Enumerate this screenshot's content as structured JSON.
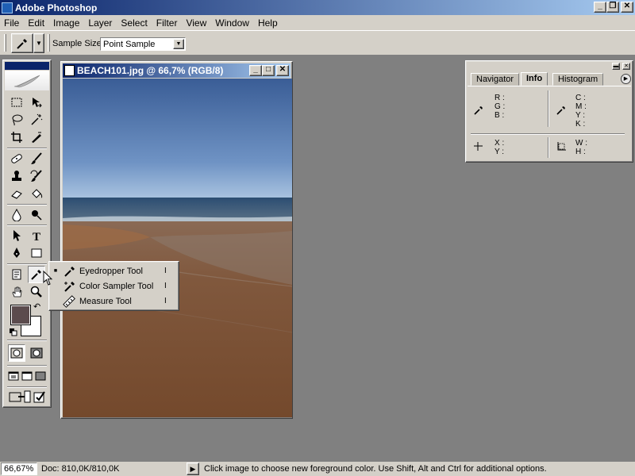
{
  "app": {
    "title": "Adobe Photoshop"
  },
  "menu": [
    "File",
    "Edit",
    "Image",
    "Layer",
    "Select",
    "Filter",
    "View",
    "Window",
    "Help"
  ],
  "options": {
    "sample_size_label": "Sample Size:",
    "sample_size_value": "Point Sample"
  },
  "document": {
    "title": "BEACH101.jpg @ 66,7% (RGB/8)"
  },
  "toolbox": {
    "tools": [
      "marquee-tool",
      "move-tool",
      "lasso-tool",
      "magic-wand-tool",
      "crop-tool",
      "slice-tool",
      "healing-brush-tool",
      "brush-tool",
      "clone-stamp-tool",
      "history-brush-tool",
      "eraser-tool",
      "paint-bucket-tool",
      "blur-tool",
      "dodge-tool",
      "path-selection-tool",
      "type-tool",
      "pen-tool",
      "rectangle-tool",
      "notes-tool",
      "eyedropper-tool",
      "hand-tool",
      "zoom-tool"
    ],
    "foreground_color": "#5b4b4d",
    "background_color": "#ffffff"
  },
  "flyout": {
    "items": [
      {
        "label": "Eyedropper Tool",
        "shortcut": "I",
        "selected": true
      },
      {
        "label": "Color Sampler Tool",
        "shortcut": "I",
        "selected": false
      },
      {
        "label": "Measure Tool",
        "shortcut": "I",
        "selected": false
      }
    ]
  },
  "info_palette": {
    "tabs": [
      "Navigator",
      "Info",
      "Histogram"
    ],
    "active_tab": "Info",
    "rgb_labels": [
      "R :",
      "G :",
      "B :"
    ],
    "cmyk_labels": [
      "C :",
      "M :",
      "Y :",
      "K :"
    ],
    "xy_labels": [
      "X :",
      "Y :"
    ],
    "wh_labels": [
      "W :",
      "H :"
    ]
  },
  "status": {
    "zoom": "66,67%",
    "doc_size": "Doc: 810,0K/810,0K",
    "message": "Click image to choose new foreground color.  Use Shift, Alt and Ctrl for additional options."
  }
}
